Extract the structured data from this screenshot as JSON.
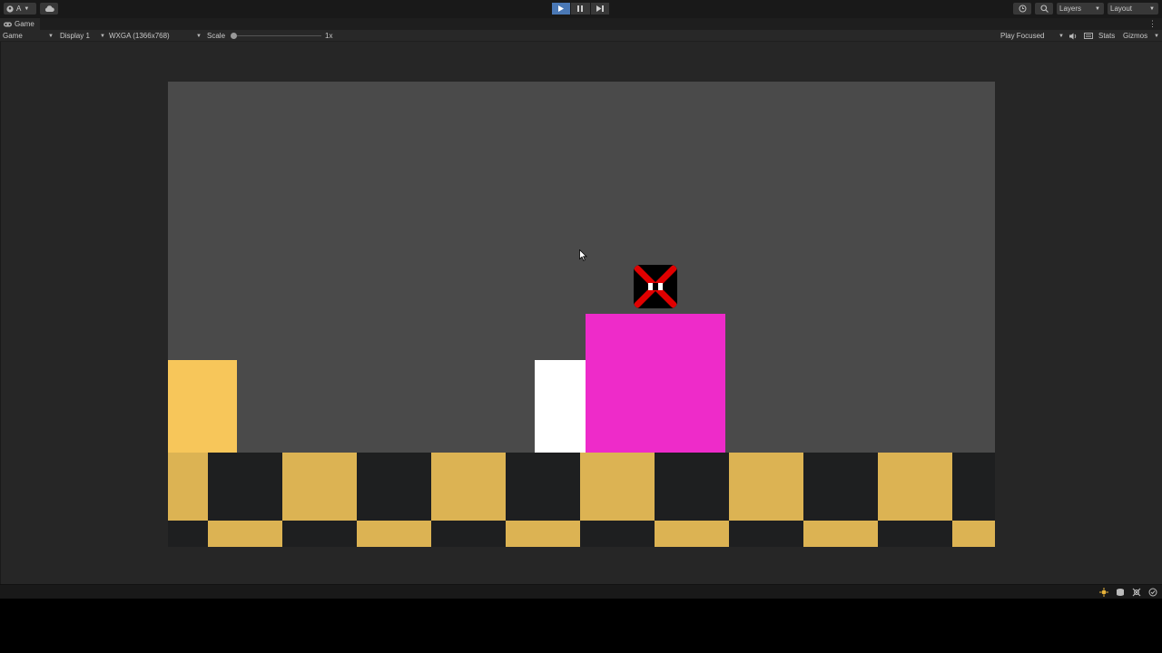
{
  "toolbar": {
    "account_label": "A",
    "layers_label": "Layers",
    "layout_label": "Layout",
    "play_active": true
  },
  "tab": {
    "label": "Game"
  },
  "game_controls": {
    "view_label": "Game",
    "display_label": "Display 1",
    "resolution_label": "WXGA (1366x768)",
    "scale_label": "Scale",
    "scale_value": "1x",
    "play_focused_label": "Play Focused",
    "stats_label": "Stats",
    "gizmos_label": "Gizmos"
  },
  "scene": {
    "background_color": "#4a4a4a",
    "blocks": [
      {
        "name": "yellow-block",
        "color": "#f7c65a"
      },
      {
        "name": "white-block",
        "color": "#ffffff"
      },
      {
        "name": "magenta-block",
        "color": "#ee2bc9"
      }
    ],
    "enemy": {
      "name": "x-marked-block",
      "color": "#000000",
      "mark_color": "#e00000"
    },
    "floor": {
      "pattern": "checkerboard",
      "colors": [
        "#dcb353",
        "#1e1f20"
      ]
    }
  },
  "icons": {
    "account": "account-icon",
    "cloud": "cloud-icon",
    "play": "play-icon",
    "pause": "pause-icon",
    "step": "step-icon",
    "history": "history-icon",
    "search": "search-icon",
    "mute": "audio-icon",
    "stats": "stats-icon",
    "more": "kebab-menu-icon"
  }
}
